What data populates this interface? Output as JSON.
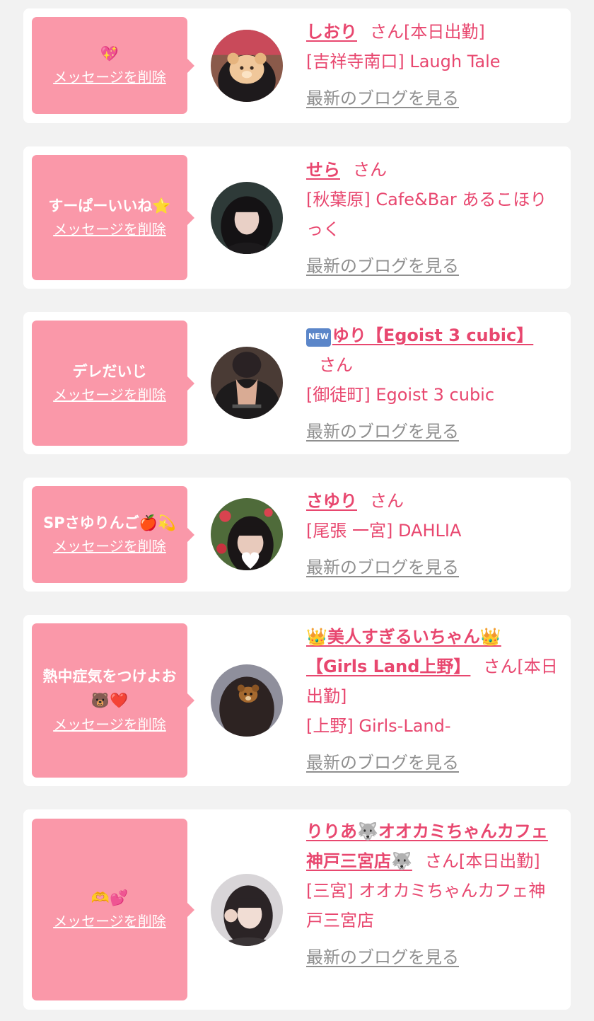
{
  "colors": {
    "background": "#f2f2f2",
    "card": "#ffffff",
    "bubble": "#fa98a9",
    "accent": "#e8476f",
    "blog_link": "#8f8f8f"
  },
  "delete_label": "メッセージを削除",
  "blog_label": "最新のブログを見る",
  "new_badge": "NEW",
  "items": [
    {
      "message": "💖",
      "name": "しおり",
      "suffix": "さん[本日出勤]",
      "shop": "[吉祥寺南口] Laugh Tale",
      "avatar_icon": "bear-sticker-photo"
    },
    {
      "message": "すーぱーいいね⭐",
      "name": "せら",
      "suffix": "さん",
      "shop": "[秋葉原] Cafe&Bar あるこほりっく",
      "avatar_icon": "portrait-photo"
    },
    {
      "message": "デレだいじ",
      "name": "ゆり【Egoist 3 cubic】",
      "suffix": "さん",
      "shop": "[御徒町] Egoist 3 cubic",
      "avatar_icon": "portrait-photo",
      "has_new_badge": true
    },
    {
      "message": "SPさゆりんご🍎💫",
      "name": "さゆり",
      "suffix": "さん",
      "shop": "[尾張 一宮] DAHLIA",
      "avatar_icon": "heart-sticker-photo"
    },
    {
      "message": "熱中症気をつけよお🐻❤️",
      "name": "👑美人すぎるいちゃん👑【Girls Land上野】",
      "suffix": "さん[本日出勤]",
      "shop": "[上野] Girls-Land-",
      "avatar_icon": "bear-sticker-photo"
    },
    {
      "message": "🫶💕",
      "name": "りりあ🐺オオカミちゃんカフェ神戸三宮店🐺",
      "suffix": "さん[本日出勤]",
      "shop": "[三宮] オオカミちゃんカフェ神戸三宮店",
      "avatar_icon": "portrait-photo"
    }
  ]
}
